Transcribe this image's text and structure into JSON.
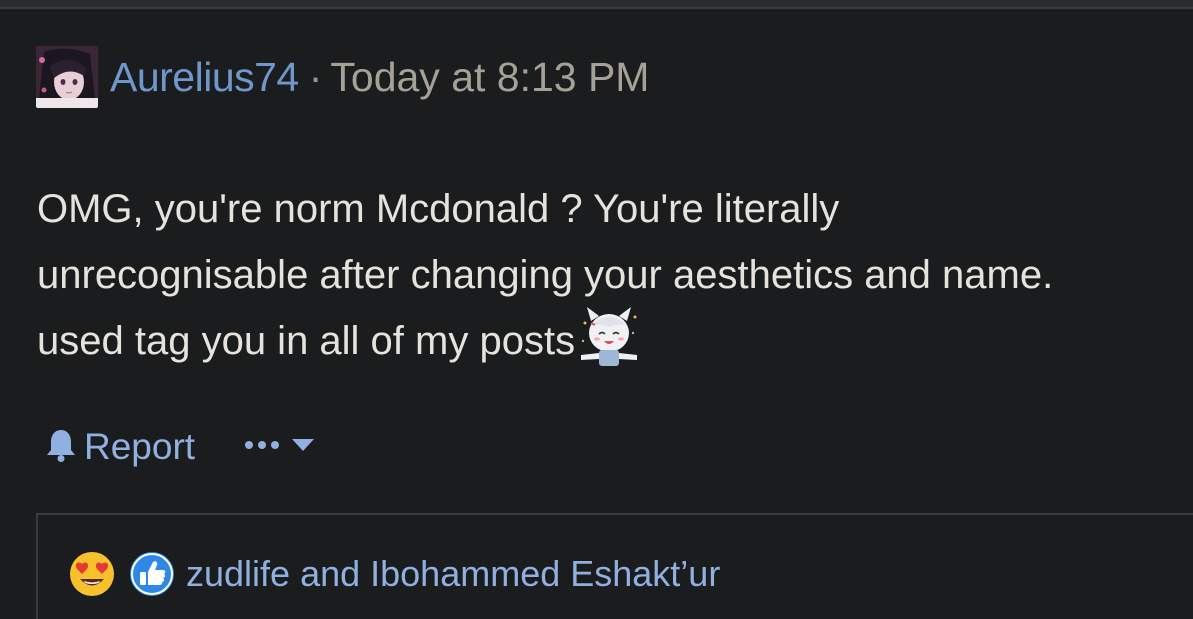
{
  "post": {
    "username": "Aurelius74",
    "separator": "·",
    "timestamp": "Today at 8:13 PM",
    "lines": [
      "OMG, you're norm Mcdonald ? You're literally",
      "unrecognisable after changing your aesthetics and name.",
      "used tag you in all of my posts"
    ],
    "sticker": "anime-girl-sticker"
  },
  "actions": {
    "report_label": "Report",
    "report_icon": "bell-icon",
    "more_icon": "ellipsis-icon",
    "dropdown_icon": "caret-down-icon"
  },
  "reactions": {
    "icons": [
      "heart-eyes-emoji",
      "thumbs-up-icon"
    ],
    "names": "zudlife and Ibohammed Eshakt’ur"
  },
  "colors": {
    "background": "#1b1c1e",
    "username": "#6f97cc",
    "link": "#8fb0e0",
    "text": "#e6e3dd",
    "timestamp": "#a6a196"
  }
}
